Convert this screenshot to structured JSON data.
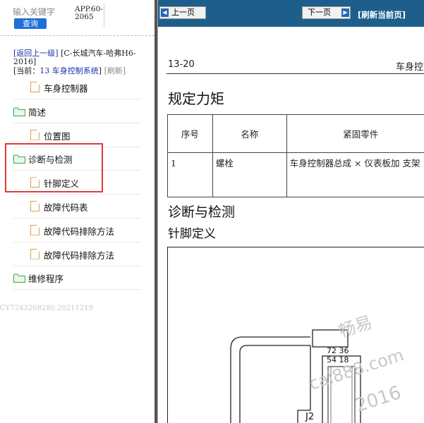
{
  "sidebar": {
    "search": {
      "placeholder": "输入关键字",
      "button_label": "查询"
    },
    "app_code": "APP.60-2065",
    "breadcrumb": {
      "up_link": "[返回上一级]",
      "path": "[C-长城汽车-哈弗H6-2016]",
      "current_prefix": "[当前：",
      "current_section": "13 车身控制系统",
      "current_suffix": "]",
      "refresh": "[刷新]"
    },
    "tree": [
      {
        "label": "车身控制器",
        "type": "document",
        "level": 1
      },
      {
        "label": "简述",
        "type": "folder",
        "level": 0
      },
      {
        "label": "位置图",
        "type": "document",
        "level": 1
      },
      {
        "label": "诊断与检测",
        "type": "folder",
        "level": 0,
        "expanded": true,
        "highlighted": true
      },
      {
        "label": "针脚定义",
        "type": "document",
        "level": 1,
        "highlighted": true
      },
      {
        "label": "故障代码表",
        "type": "document",
        "level": 1
      },
      {
        "label": "故障代码排除方法",
        "type": "document",
        "level": 1
      },
      {
        "label": "故障代码排除方法",
        "type": "document",
        "level": 1
      },
      {
        "label": "维修程序",
        "type": "folder",
        "level": 0
      }
    ],
    "serial": "CY7243268280.20211219"
  },
  "document": {
    "toolbar": {
      "prev_label": "上一页",
      "next_label": "下一页",
      "refresh_label": "[刷新当前页]"
    },
    "page_number": "13-20",
    "section_heading": "车身控",
    "torque_title": "规定力矩",
    "torque_table": {
      "headers": [
        "序号",
        "名称",
        "紧固零件"
      ],
      "rows": [
        [
          "1",
          "螺栓",
          "车身控制器总成 × 仪表板加 支架"
        ]
      ]
    },
    "diag_title": "诊断与检测",
    "pin_title": "针脚定义",
    "connector": {
      "pins_top": "72 36",
      "pins_bottom": "54 18",
      "label": "J2"
    },
    "watermark": {
      "brand": "畅易",
      "site": "cai888.com",
      "code": "2016"
    }
  },
  "colors": {
    "toolbar_bg": "#1d5f8a",
    "search_button": "#1e6fd6",
    "link": "#1a33a8",
    "highlight_box": "#e03a3a",
    "folder_icon": "#3aa84a",
    "document_icon": "#d3a45a"
  },
  "icons": {
    "search_button": "search-button",
    "prev": "arrow-left-icon",
    "next": "arrow-right-icon",
    "folder": "folder-icon",
    "document": "document-icon"
  }
}
